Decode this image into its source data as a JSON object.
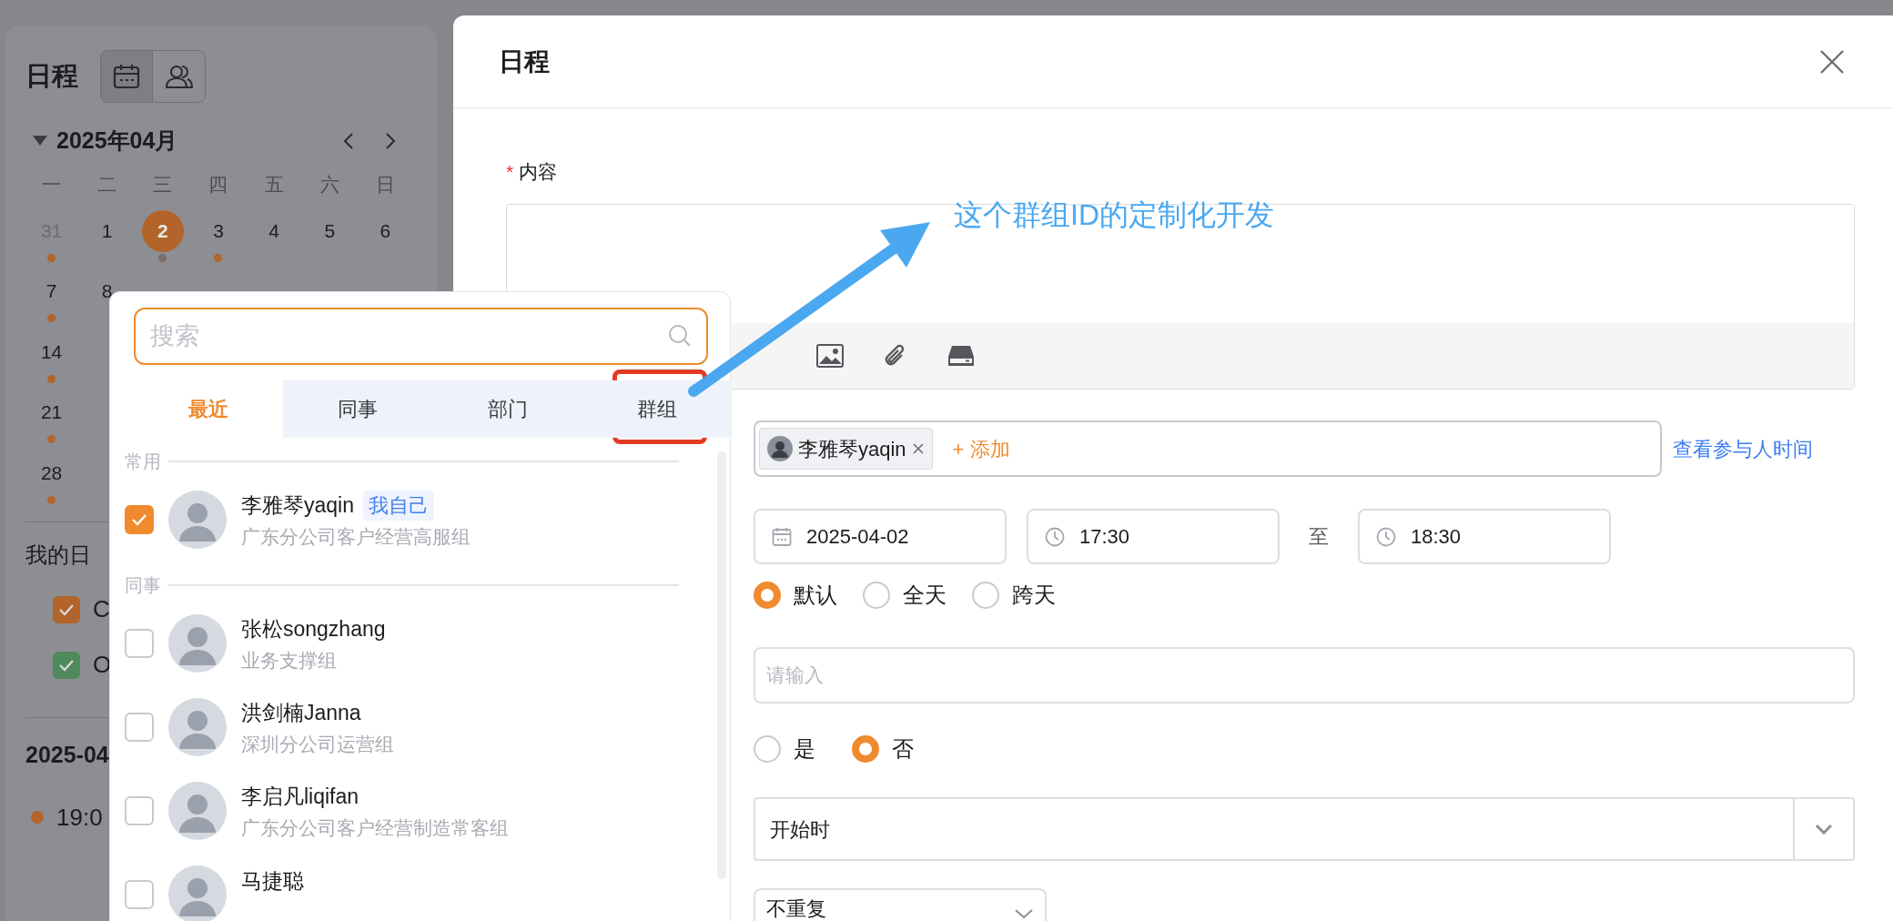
{
  "sidebar": {
    "title": "日程",
    "month": "2025年04月",
    "weekdays": [
      "一",
      "二",
      "三",
      "四",
      "五",
      "六",
      "日"
    ],
    "weeks": [
      [
        {
          "day": "31",
          "outside": true,
          "selected": false,
          "dot": true
        },
        {
          "day": "1",
          "outside": false,
          "selected": false,
          "dot": false
        },
        {
          "day": "2",
          "outside": false,
          "selected": true,
          "dot": true
        },
        {
          "day": "3",
          "outside": false,
          "selected": false,
          "dot": true
        },
        {
          "day": "4",
          "outside": false,
          "selected": false,
          "dot": false
        },
        {
          "day": "5",
          "outside": false,
          "selected": false,
          "dot": false
        },
        {
          "day": "6",
          "outside": false,
          "selected": false,
          "dot": false
        }
      ],
      [
        {
          "day": "7",
          "outside": false,
          "selected": false,
          "dot": true
        },
        {
          "day": "8",
          "outside": false,
          "selected": false,
          "dot": false
        }
      ],
      [
        {
          "day": "14",
          "outside": false,
          "selected": false,
          "dot": true
        }
      ],
      [
        {
          "day": "21",
          "outside": false,
          "selected": false,
          "dot": true
        }
      ],
      [
        {
          "day": "28",
          "outside": false,
          "selected": false,
          "dot": true
        }
      ]
    ],
    "my_calendars": {
      "title": "我的日",
      "items": [
        {
          "label": "C",
          "checked": true,
          "color": "#b3642a"
        },
        {
          "label": "O",
          "checked": true,
          "color": "#4f8a5c"
        }
      ]
    },
    "agenda": {
      "date": "2025-04",
      "events": [
        {
          "time": "19:0",
          "color": "#b3642a"
        }
      ]
    }
  },
  "picker": {
    "search": {
      "placeholder": "搜索"
    },
    "tabs": [
      {
        "label": "最近",
        "selected": true,
        "annotated": false
      },
      {
        "label": "同事",
        "selected": false,
        "annotated": false
      },
      {
        "label": "部门",
        "selected": false,
        "annotated": false
      },
      {
        "label": "群组",
        "selected": false,
        "annotated": true
      }
    ],
    "sections": [
      {
        "title": "常用",
        "people": [
          {
            "name": "李雅琴yaqin",
            "tag": "我自己",
            "dept": "广东分公司客户经营高服组",
            "checked": true
          }
        ]
      },
      {
        "title": "同事",
        "people": [
          {
            "name": "张松songzhang",
            "dept": "业务支撑组",
            "checked": false
          },
          {
            "name": "洪剑楠Janna",
            "dept": "深圳分公司运营组",
            "checked": false
          },
          {
            "name": "李启凡liqifan",
            "dept": "广东分公司客户经营制造常客组",
            "checked": false
          },
          {
            "name": "马捷聪",
            "checked": false
          }
        ]
      }
    ]
  },
  "annotation": {
    "text": "这个群组ID的定制化开发"
  },
  "modal": {
    "title": "日程",
    "content_label": "内容",
    "required_mark": "*",
    "participants": [
      {
        "name": "李雅琴yaqin"
      }
    ],
    "add_label": "+ 添加",
    "view_time_link": "查看参与人时间",
    "date": "2025-04-02",
    "start_time": "17:30",
    "to_label": "至",
    "end_time": "18:30",
    "day_types": [
      {
        "label": "默认",
        "selected": true
      },
      {
        "label": "全天",
        "selected": false
      },
      {
        "label": "跨天",
        "selected": false
      }
    ],
    "text_field": {
      "placeholder": "请输入"
    },
    "yes_no": [
      {
        "label": "是",
        "selected": false
      },
      {
        "label": "否",
        "selected": true
      }
    ],
    "reminder": {
      "value": "开始时"
    },
    "repeat": {
      "value": "不重复"
    }
  }
}
